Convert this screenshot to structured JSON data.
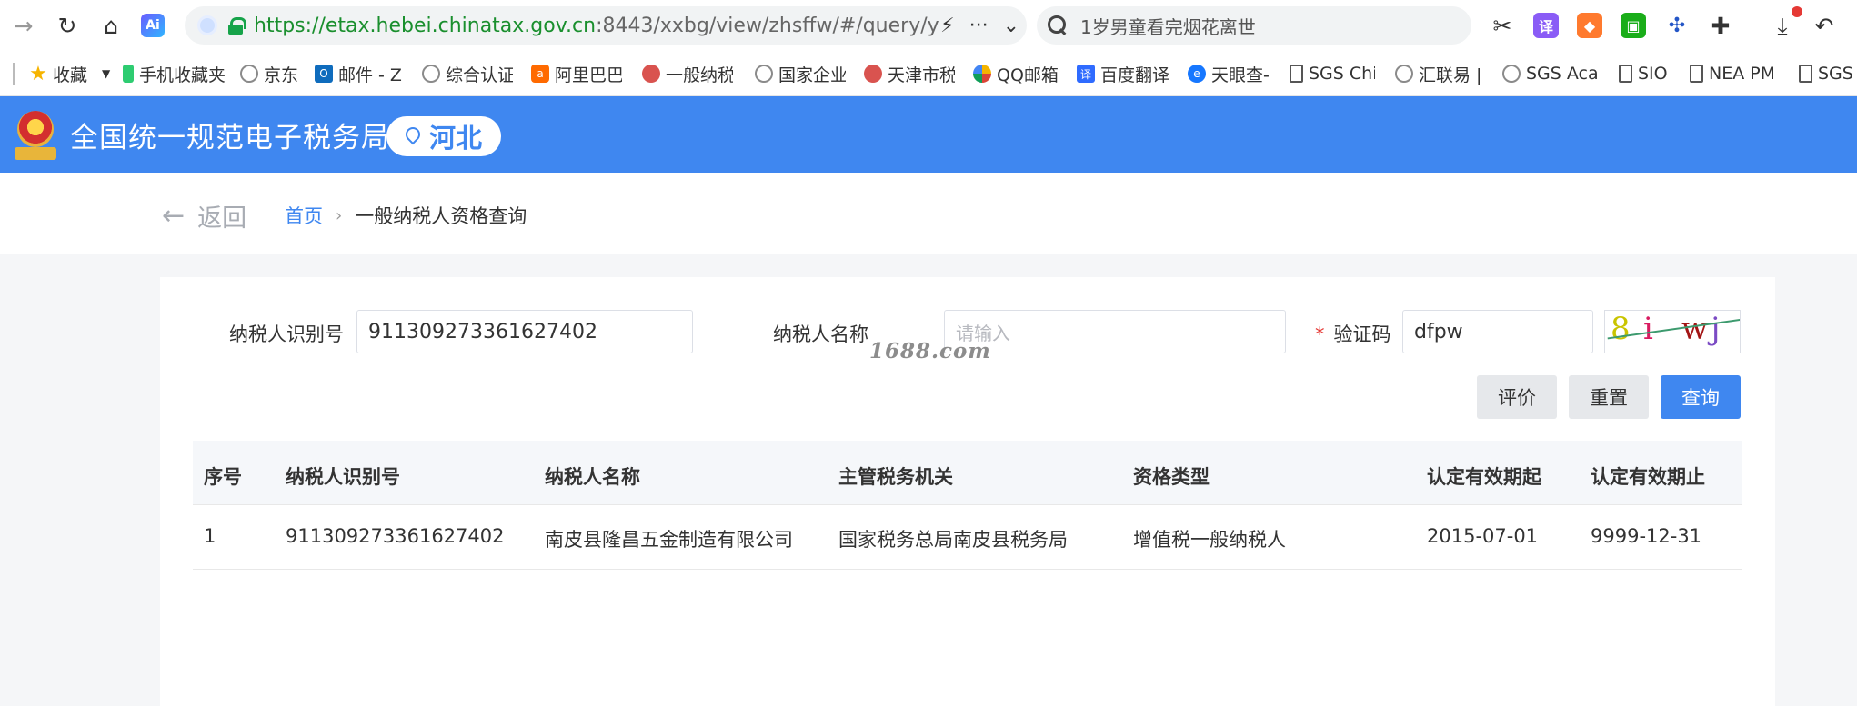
{
  "browser": {
    "url_scheme": "https://",
    "url_host": "etax.hebei.chinatax.gov.cn",
    "url_rest": ":8443/xxbg/view/zhsffw/#/query/y",
    "search_text": "1岁男童看完烟花离世",
    "extensions": [
      "translate",
      "game",
      "wechat",
      "network",
      "puzzle"
    ],
    "ext_translate_label": "译"
  },
  "bookmarks": [
    {
      "label": "收藏",
      "icon": "star-icon"
    },
    {
      "label": "手机收藏夹",
      "icon": "phone-icon"
    },
    {
      "label": "京东",
      "icon": "globe-icon"
    },
    {
      "label": "邮件 - Z",
      "icon": "outlook-icon"
    },
    {
      "label": "综合认证",
      "icon": "globe-icon"
    },
    {
      "label": "阿里巴巴",
      "icon": "alibaba-icon"
    },
    {
      "label": "一般纳税",
      "icon": "emblem-icon"
    },
    {
      "label": "国家企业",
      "icon": "globe-icon"
    },
    {
      "label": "天津市税",
      "icon": "emblem-icon"
    },
    {
      "label": "QQ邮箱",
      "icon": "qqmail-icon"
    },
    {
      "label": "百度翻译",
      "icon": "baidu-translate-icon"
    },
    {
      "label": "天眼查-",
      "icon": "tianyancha-icon"
    },
    {
      "label": "SGS Chi",
      "icon": "document-icon"
    },
    {
      "label": "汇联易 |",
      "icon": "globe-icon"
    },
    {
      "label": "SGS Aca",
      "icon": "globe-icon"
    },
    {
      "label": "SIO",
      "icon": "document-icon"
    },
    {
      "label": "NEA PM",
      "icon": "document-icon"
    },
    {
      "label": "SGS",
      "icon": "document-icon"
    }
  ],
  "header": {
    "site_title": "全国统一规范电子税务局",
    "region": "河北"
  },
  "breadcrumb": {
    "back_label": "返回",
    "home": "首页",
    "current": "一般纳税人资格查询"
  },
  "form": {
    "taxpayer_id_label": "纳税人识别号",
    "taxpayer_id_value": "911309273361627402",
    "taxpayer_name_label": "纳税人名称",
    "taxpayer_name_placeholder": "请输入",
    "captcha_label": "验证码",
    "captcha_value": "dfpw",
    "captcha_image_text": "8iwj",
    "watermark": "1688.com",
    "buttons": {
      "evaluate": "评价",
      "reset": "重置",
      "query": "查询"
    }
  },
  "table": {
    "columns": [
      "序号",
      "纳税人识别号",
      "纳税人名称",
      "主管税务机关",
      "资格类型",
      "认定有效期起",
      "认定有效期止"
    ],
    "rows": [
      [
        "1",
        "911309273361627402",
        "南皮县隆昌五金制造有限公司",
        "国家税务总局南皮县税务局",
        "增值税一般纳税人",
        "2015-07-01",
        "9999-12-31"
      ]
    ]
  },
  "colors": {
    "brand_blue": "#3f87f0",
    "required_red": "#e53935",
    "secure_green": "#1a8f2e"
  }
}
